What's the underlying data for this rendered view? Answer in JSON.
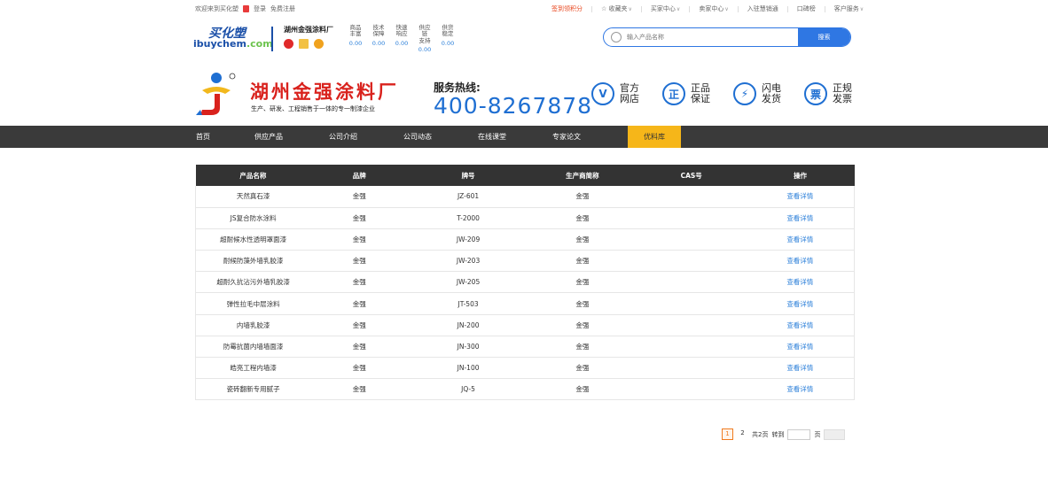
{
  "topbar": {
    "welcome": "欢迎来到买化塑",
    "login": "登录",
    "register": "免费注册",
    "checkin": "签到领积分",
    "favorites": "☆ 收藏夹",
    "buyer_center": "买家中心",
    "seller_center": "卖家中心",
    "join": "入驻慧销通",
    "reputation": "口碑榜",
    "service": "客户服务"
  },
  "brand": {
    "cn": "买化塑",
    "en_a": "ibuy",
    "en_b": "chem",
    "en_c": ".com"
  },
  "shop": {
    "name": "湖州金强涂料厂",
    "stats": [
      {
        "label1": "商品",
        "label2": "丰富",
        "value": "0.00"
      },
      {
        "label1": "技术",
        "label2": "保障",
        "value": "0.00"
      },
      {
        "label1": "快速",
        "label2": "响应",
        "value": "0.00"
      },
      {
        "label1": "供应链",
        "label2": "支持",
        "value": "0.00"
      },
      {
        "label1": "供货",
        "label2": "稳定",
        "value": "0.00"
      }
    ]
  },
  "search": {
    "placeholder": "输入产品名称",
    "button": "搜索"
  },
  "company": {
    "name": "湖州金强涂料厂",
    "sub": "生产、研发、工程销售于一体的专一制漆企业",
    "hotline_label": "服务热线:",
    "hotline": "400-8267878"
  },
  "features": [
    {
      "icon": "V",
      "l1": "官方",
      "l2": "网店"
    },
    {
      "icon": "正",
      "l1": "正品",
      "l2": "保证"
    },
    {
      "icon": "⚡",
      "l1": "闪电",
      "l2": "发货"
    },
    {
      "icon": "票",
      "l1": "正规",
      "l2": "发票"
    }
  ],
  "nav": [
    "首页",
    "供应产品",
    "公司介绍",
    "公司动态",
    "在线课堂",
    "专家论文",
    "优料库"
  ],
  "table": {
    "headers": [
      "产品名称",
      "品牌",
      "牌号",
      "生产商简称",
      "CAS号",
      "操作"
    ],
    "action": "查看详情",
    "rows": [
      [
        "天然真石漆",
        "金强",
        "JZ-601",
        "金强",
        ""
      ],
      [
        "JS复合防水涂料",
        "金强",
        "T-2000",
        "金强",
        ""
      ],
      [
        "超耐候水性透明罩面漆",
        "金强",
        "JW-209",
        "金强",
        ""
      ],
      [
        "耐候防藻外墙乳胶漆",
        "金强",
        "JW-203",
        "金强",
        ""
      ],
      [
        "超耐久抗沾污外墙乳胶漆",
        "金强",
        "JW-205",
        "金强",
        ""
      ],
      [
        "弹性拉毛中层涂料",
        "金强",
        "JT-503",
        "金强",
        ""
      ],
      [
        "内墙乳胶漆",
        "金强",
        "JN-200",
        "金强",
        ""
      ],
      [
        "防霉抗菌内墙墙面漆",
        "金强",
        "JN-300",
        "金强",
        ""
      ],
      [
        "皓亮工程内墙漆",
        "金强",
        "JN-100",
        "金强",
        ""
      ],
      [
        "瓷砖翻新专用腻子",
        "金强",
        "JQ-5",
        "金强",
        ""
      ]
    ]
  },
  "pager": {
    "p1": "1",
    "p2": "2",
    "total": "共2页",
    "goto": "转到",
    "page": "页"
  }
}
